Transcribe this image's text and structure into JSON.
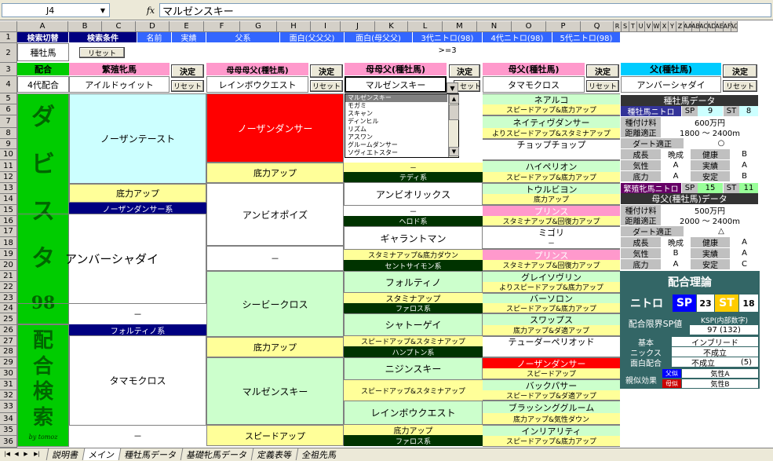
{
  "formula_bar": {
    "cell_ref": "J4",
    "fx": "fx",
    "value": "マルゼンスキー"
  },
  "columns": [
    "A",
    "B",
    "C",
    "D",
    "E",
    "F",
    "G",
    "H",
    "I",
    "J",
    "K",
    "L",
    "M",
    "N",
    "O",
    "P",
    "Q",
    "R",
    "S",
    "T",
    "U",
    "V",
    "W",
    "X",
    "Y",
    "Z",
    "AA",
    "AB",
    "AC",
    "AD",
    "AE",
    "AF",
    "AG"
  ],
  "rows": [
    "1",
    "2",
    "3",
    "4",
    "5",
    "6",
    "7",
    "8",
    "9",
    "10",
    "11",
    "12",
    "13",
    "14",
    "15",
    "16",
    "17",
    "18",
    "19",
    "20",
    "21",
    "22",
    "23",
    "24",
    "25",
    "26",
    "27",
    "28",
    "29",
    "30",
    "31",
    "32",
    "33",
    "34",
    "35",
    "36"
  ],
  "row1": {
    "a": "検索切替",
    "bc": "検索条件",
    "d": "名前",
    "e": "実績",
    "fg": "父系",
    "hi": "面白(父父父)",
    "jk": "面白(母父父)",
    "lm": "3代ニトロ(98)",
    "no": "4代ニトロ(98)",
    "pq": "5代ニトロ(98)"
  },
  "row2": {
    "a": "種牡馬",
    "reset": "リセット",
    "lm": ">=3"
  },
  "row3": {
    "a": "配合",
    "bc": "繁殖牝馬",
    "fg": "母母母父(種牡馬)",
    "jk": "母母父(種牡馬)",
    "no": "母父(種牡馬)",
    "rs": "父(種牡馬)",
    "decide": "決定"
  },
  "row4": {
    "a": "4代配合",
    "bc": "アイルドゥイット",
    "fg": "レインボウクエスト",
    "jk": "マルゼンスキー",
    "no": "タマモクロス",
    "rs": "アンバーシャダイ",
    "reset": "リセット"
  },
  "dropdown_options": [
    "マルゼンスキー",
    "モガミ",
    "スキャン",
    "ディンヒル",
    "リズム",
    "アスワン",
    "グルームダンサー",
    "ソヴィエトスター"
  ],
  "side_a_top": {
    "chars": [
      "ダ",
      "ビ",
      "ス",
      "タ",
      "98"
    ]
  },
  "side_a_bottom": {
    "chars": [
      "配",
      "合",
      "検",
      "索"
    ],
    "credit": "by tomoz"
  },
  "col_bc": {
    "b1": "ノーザンテースト",
    "b2": "底力アップ",
    "b3": "ノーザンダンサー系",
    "b4": "アンバーシャダイ",
    "b5": "－",
    "b6": "フォルティノ系",
    "b7": "タマモクロス",
    "b8": "－"
  },
  "col_fg": {
    "f1": "ノーザンダンサー",
    "f2": "底力アップ",
    "f3": "アンビオポイズ",
    "f4": "－",
    "f5": "シービークロス",
    "f6": "底力アップ",
    "f7": "マルゼンスキー",
    "f8": "スピードアップ"
  },
  "col_jk": {
    "j1a": "－",
    "j1b": "テディ系",
    "j2": "アンビオリックス",
    "j2a": "－",
    "j2b": "ヘロド系",
    "j3": "ギャラントマン",
    "j3a": "スタミナアップ&底力ダウン",
    "j3b": "セントサイモン系",
    "j4": "フォルティノ",
    "j4a": "スタミナアップ",
    "j4b": "ファロス系",
    "j5": "シャトーゲイ",
    "j5a": "スピードアップ&スタミナアップ",
    "j5b": "ハンプトン系",
    "j6": "ニジンスキー",
    "j6a": "スピードアップ&スタミナアップ",
    "j7": "レインボウクエスト",
    "j7a": "底力アップ",
    "j7b": "ファロス系"
  },
  "col_no": [
    {
      "t": "ネアルコ",
      "s": "スピードアップ&底力アップ"
    },
    {
      "t": "ネイティヴダンサー",
      "s": "よりスピードアップ&スタミナアップ"
    },
    {
      "t": "チョップチョップ",
      "s": ""
    },
    {
      "t": "ハイペリオン",
      "s": "スピードアップ&底力アップ"
    },
    {
      "t": "トウルビヨン",
      "s": "底力アップ"
    },
    {
      "t": "プリンス",
      "s": "スタミナアップ&回復力アップ"
    },
    {
      "t": "ミゴリ",
      "s": "－"
    },
    {
      "t": "プリンス",
      "s": "スタミナアップ&回復力アップ"
    },
    {
      "t": "グレイソヴリン",
      "s": "よりスピードアップ&底力アップ"
    },
    {
      "t": "バーソロン",
      "s": "スピードアップ&底力アップ"
    },
    {
      "t": "スワップス",
      "s": "底力アップ&ダ適アップ"
    },
    {
      "t": "テューダーペリオッド",
      "s": ""
    },
    {
      "t": "ノーザンダンサー",
      "s": "スピードアップ"
    },
    {
      "t": "バックパサー",
      "s": "スピードアップ&ダ適アップ"
    },
    {
      "t": "ブラッシンググルーム",
      "s": "底力アップ&気性ダウン"
    },
    {
      "t": "インリアリティ",
      "s": "スピードアップ&底力アップ"
    }
  ],
  "sire_data": {
    "title": "種牡馬データ",
    "nitro_label": "種牡馬ニトロ",
    "sp_label": "SP",
    "sp": "9",
    "st_label": "ST",
    "st": "8",
    "fee_label": "種付け料",
    "fee": "600万円",
    "dist_label": "距離適正",
    "dist": "1800 ～ 2400m",
    "dirt_label": "ダート適正",
    "dirt": "○",
    "grow_label": "成長",
    "grow": "晩成",
    "health_label": "健康",
    "health": "B",
    "temper_label": "気性",
    "temper": "A",
    "record_label": "実績",
    "record": "A",
    "power_label": "底力",
    "power": "A",
    "stable_label": "安定",
    "stable": "B"
  },
  "broodsire_data": {
    "nitro_label": "繁殖牝馬ニトロ",
    "sp_label": "SP",
    "sp": "15",
    "st_label": "ST",
    "st": "11",
    "title": "母父(種牡馬)データ",
    "fee_label": "種付け料",
    "fee": "500万円",
    "dist_label": "距離適正",
    "dist": "2000 ～ 2400m",
    "dirt_label": "ダート適正",
    "dirt": "△",
    "grow_label": "成長",
    "grow": "晩成",
    "health_label": "健康",
    "health": "A",
    "temper_label": "気性",
    "temper": "B",
    "record_label": "実績",
    "record": "A",
    "power_label": "底力",
    "power": "A",
    "stable_label": "安定",
    "stable": "C"
  },
  "theory": {
    "title": "配合理論",
    "nitro": "ニトロ",
    "sp_label": "SP",
    "sp": "23",
    "st_label": "ST",
    "st": "18",
    "limit_label": "配合限界SP値",
    "ksp_label": "KSP(内部数字)",
    "ksp": "97 (132)",
    "basic_label": "基本",
    "basic": "インブリード",
    "nicks_label": "ニックス",
    "nicks": "不成立",
    "omoshiro_label": "面白配合",
    "omoshiro": "不成立",
    "omoshiro_n": "(5)",
    "similar_label": "親似効果",
    "father_tag": "父似",
    "father_val": "気性A",
    "mother_tag": "母似",
    "mother_val": "気性B"
  },
  "sheet_tabs": [
    "説明書",
    "メイン",
    "種牡馬データ",
    "基礎牝馬データ",
    "定義表等",
    "全祖先馬"
  ],
  "colors": {
    "blue": "#3366ff",
    "pink": "#ff99cc",
    "cyan": "#ccffff",
    "yellow": "#ffff99",
    "lightgreen": "#ccffcc",
    "darkgreen": "#003300",
    "navy": "#000080",
    "green": "#00cc00",
    "teal": "#336666",
    "red": "#ff0000"
  }
}
